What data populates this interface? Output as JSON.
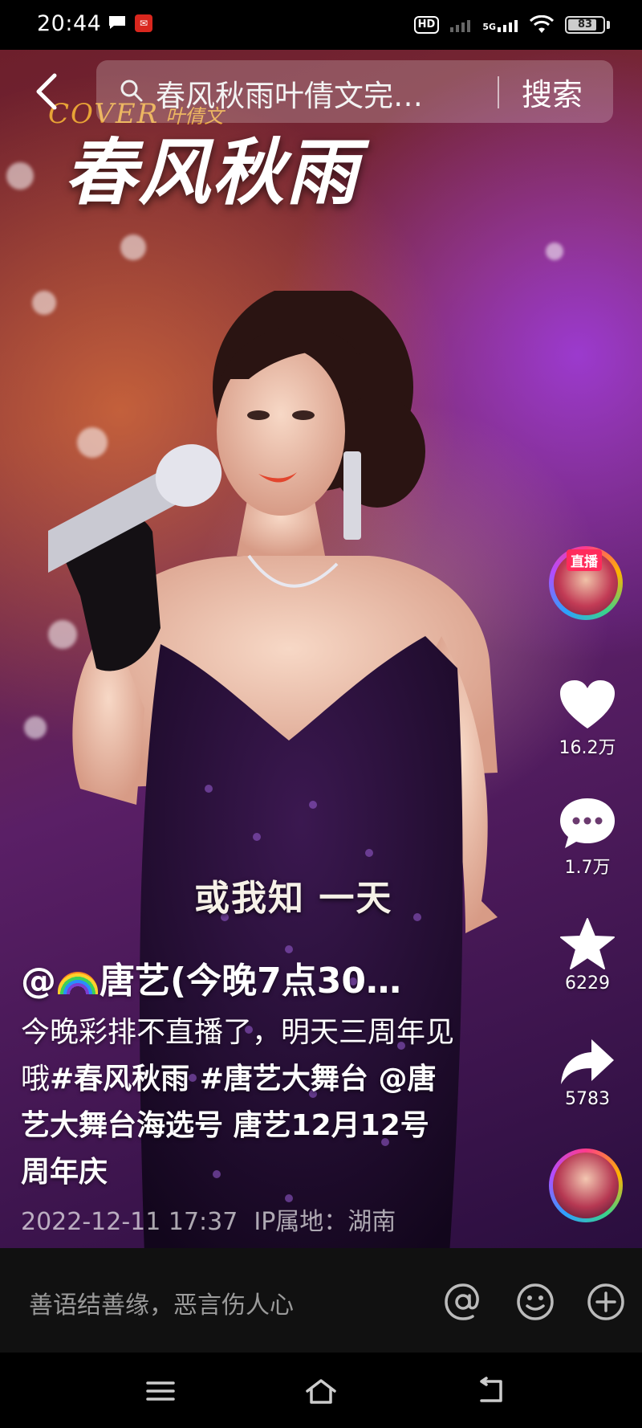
{
  "status_bar": {
    "time": "20:44",
    "hd_label": "HD",
    "network_label": "5G",
    "battery": "83",
    "battery_level": 0.83
  },
  "top_bar": {
    "search_text": "春风秋雨叶倩文完…",
    "search_button": "搜索"
  },
  "overlay": {
    "cover_word": "COVER",
    "cover_sub": "叶倩文",
    "song_title": "春风秋雨",
    "lyric": "或我知  一天"
  },
  "actions": {
    "live_badge": "直播",
    "likes": "16.2万",
    "comments": "1.7万",
    "favorites": "6229",
    "shares": "5783"
  },
  "caption": {
    "author_prefix": "@",
    "author_name": "唐艺(今晚7点30…",
    "line_text": "今晚彩排不直播了，明天三周年见哦",
    "tag1": "#春风秋雨",
    "tag2": "#唐艺大舞台",
    "mention": "@唐艺大舞台海选号",
    "tail": "唐艺12月12号周年庆",
    "date": "2022-12-11 17:37",
    "ip": "IP属地：湖南"
  },
  "comment_bar": {
    "placeholder": "善语结善缘，恶言伤人心"
  },
  "icons": {
    "back": "back-arrow-icon",
    "search": "search-icon",
    "like": "heart-icon",
    "comment": "comment-icon",
    "favorite": "star-icon",
    "share": "share-icon",
    "mention": "at-icon",
    "emoji": "emoji-icon",
    "add": "plus-icon",
    "menu": "menu-icon",
    "home": "home-icon",
    "back_nav": "back-nav-icon"
  }
}
